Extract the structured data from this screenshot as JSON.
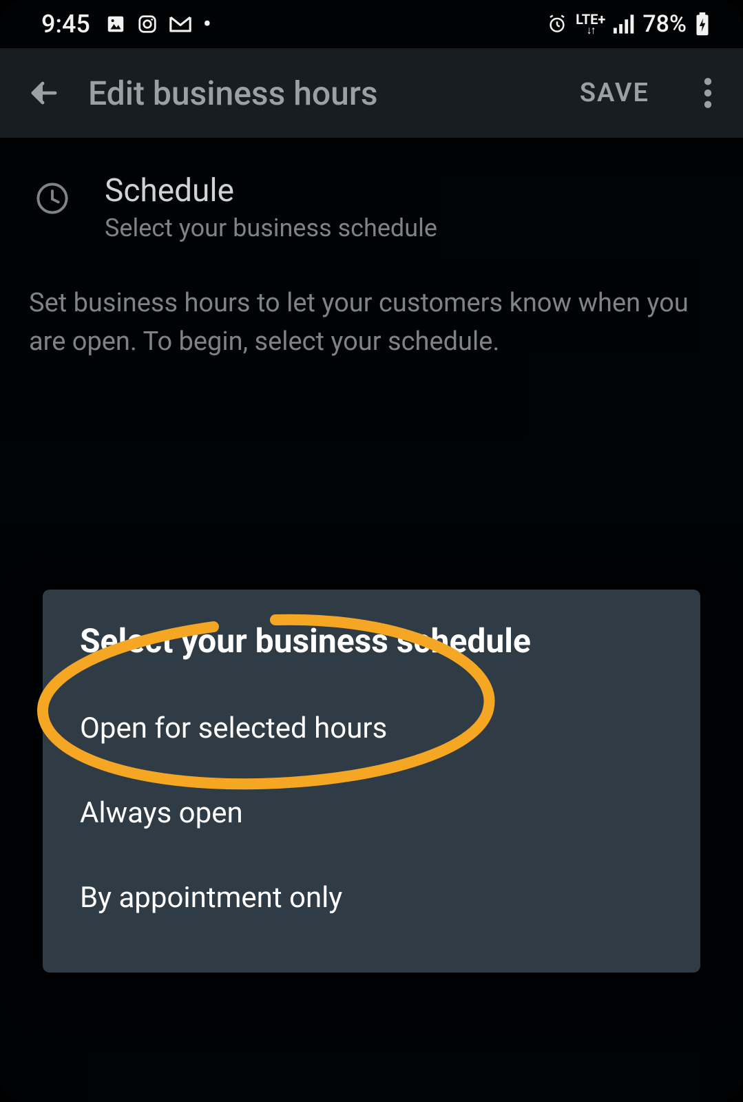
{
  "statusbar": {
    "time": "9:45",
    "lte_label": "LTE+",
    "battery_pct": "78%"
  },
  "toolbar": {
    "title": "Edit business hours",
    "save_label": "SAVE"
  },
  "schedule": {
    "heading": "Schedule",
    "sub": "Select your business schedule"
  },
  "description": "Set business hours to let your customers know when you are open. To begin, select your schedule.",
  "dialog": {
    "title": "Select your business schedule",
    "options": [
      "Open for selected hours",
      "Always open",
      "By appointment only"
    ]
  },
  "annotation": {
    "color": "#f5a623"
  }
}
